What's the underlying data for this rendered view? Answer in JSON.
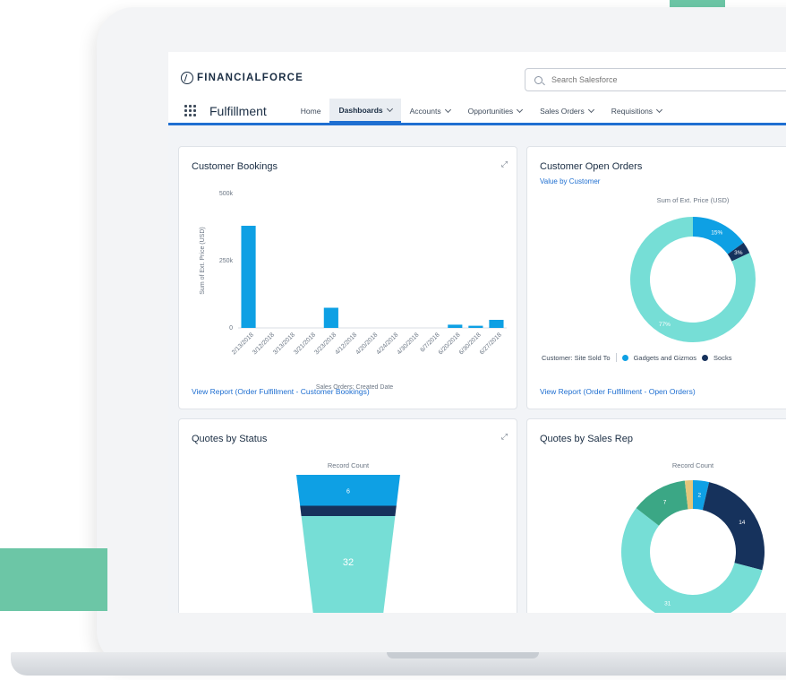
{
  "brand": {
    "name": "FINANCIALFORCE"
  },
  "search": {
    "placeholder": "Search Salesforce"
  },
  "nav": {
    "app_name": "Fulfillment",
    "items": [
      {
        "label": "Home",
        "dropdown": false,
        "active": false
      },
      {
        "label": "Dashboards",
        "dropdown": true,
        "active": true
      },
      {
        "label": "Accounts",
        "dropdown": true,
        "active": false
      },
      {
        "label": "Opportunities",
        "dropdown": true,
        "active": false
      },
      {
        "label": "Sales Orders",
        "dropdown": true,
        "active": false
      },
      {
        "label": "Requisitions",
        "dropdown": true,
        "active": false
      }
    ]
  },
  "cards": {
    "bookings": {
      "title": "Customer Bookings",
      "link": "View Report (Order Fulfillment - Customer Bookings)"
    },
    "open_orders": {
      "title": "Customer Open Orders",
      "subtitle": "Value by Customer",
      "link": "View Report (Order Fulfillment - Open Orders)",
      "legend_label": "Customer: Site Sold To",
      "legend_items": [
        "Gadgets and Gizmos",
        "Socks"
      ]
    },
    "quotes_status": {
      "title": "Quotes by Status"
    },
    "quotes_rep": {
      "title": "Quotes by Sales Rep"
    }
  },
  "colors": {
    "primary": "#1f6fd1",
    "teal": "#76ded6",
    "blue": "#0ea0e4",
    "navy": "#16325c",
    "green": "#3ba785",
    "gold": "#e3c67b",
    "accent_green": "#6cc6a6"
  },
  "chart_data": [
    {
      "type": "bar",
      "title": "",
      "ylabel": "Sum of Ext. Price (USD)",
      "xlabel": "Sales Orders: Created Date",
      "y_ticks": [
        "500k",
        "250k",
        "0"
      ],
      "ylim": [
        0,
        500000
      ],
      "categories": [
        "2/13/2018",
        "3/12/2018",
        "3/13/2018",
        "3/21/2018",
        "3/23/2018",
        "4/12/2018",
        "4/20/2018",
        "4/24/2018",
        "4/30/2018",
        "6/7/2018",
        "6/20/2018",
        "6/30/2018",
        "6/27/2018"
      ],
      "values": [
        380000,
        0,
        0,
        0,
        75000,
        0,
        0,
        0,
        0,
        0,
        12000,
        8000,
        30000
      ]
    },
    {
      "type": "pie",
      "title": "Sum of Ext. Price (USD)",
      "series": [
        {
          "name": "Gadgets and Gizmos",
          "value": 15,
          "label": "15%",
          "color": "#0ea0e4"
        },
        {
          "name": "Socks",
          "value": 3,
          "label": "3%",
          "color": "#16325c"
        },
        {
          "name": "",
          "value": 82,
          "label": "77%",
          "color": "#76ded6"
        }
      ]
    },
    {
      "type": "bar",
      "title": "Record Count",
      "series": [
        {
          "name": "",
          "value": 6,
          "label": "6",
          "color": "#0ea0e4"
        },
        {
          "name": "",
          "value": 2,
          "label": "",
          "color": "#16325c"
        },
        {
          "name": "",
          "value": 32,
          "label": "32",
          "color": "#76ded6"
        }
      ]
    },
    {
      "type": "pie",
      "title": "Record Count",
      "series": [
        {
          "name": "",
          "value": 2,
          "label": "2",
          "color": "#0ea0e4"
        },
        {
          "name": "",
          "value": 14,
          "label": "14",
          "color": "#16325c"
        },
        {
          "name": "",
          "value": 31,
          "label": "31",
          "color": "#76ded6"
        },
        {
          "name": "",
          "value": 7,
          "label": "7",
          "color": "#3ba785"
        },
        {
          "name": "",
          "value": 1,
          "label": "",
          "color": "#e3c67b"
        }
      ]
    }
  ]
}
